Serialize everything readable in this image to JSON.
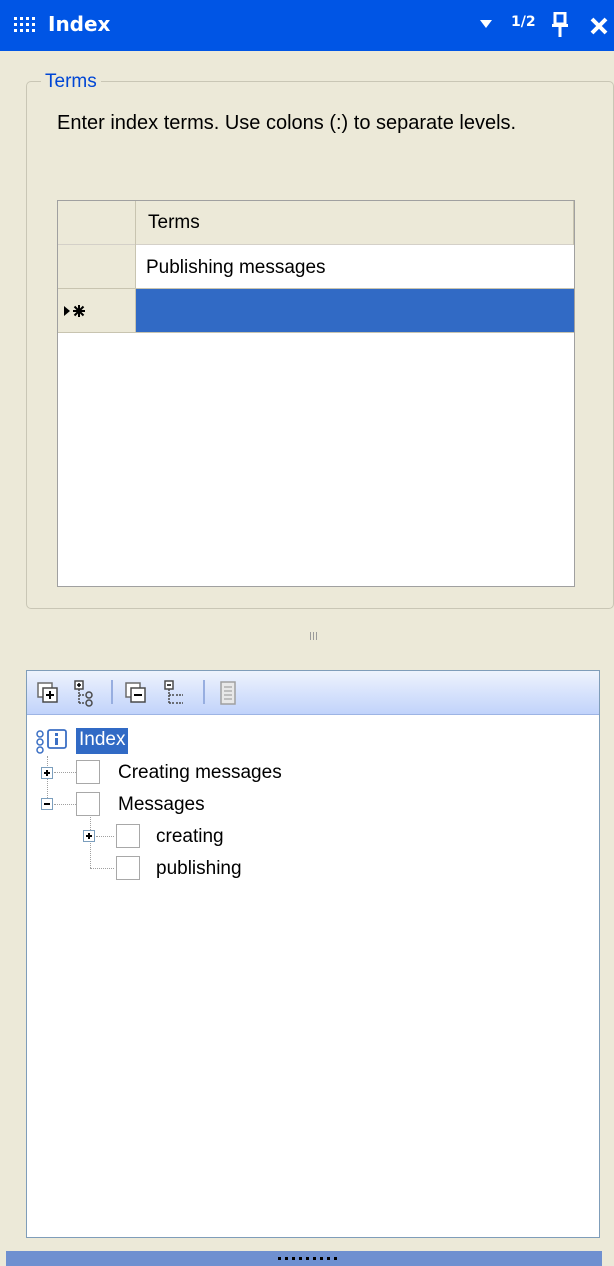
{
  "titlebar": {
    "title": "Index",
    "page_indicator": "1/2",
    "icons": [
      "grip-icon",
      "dropdown-arrow-icon",
      "pin-icon",
      "close-icon"
    ]
  },
  "terms_group": {
    "legend": "Terms",
    "instructions": "Enter index terms. Use colons (:) to separate levels."
  },
  "grid": {
    "column_header": "Terms",
    "rows": [
      {
        "value": "Publishing messages"
      },
      {
        "value": "",
        "new_row": true
      }
    ],
    "new_row_icon": "new-row-marker-icon"
  },
  "splitter": {
    "icon": "splitter-grip-icon"
  },
  "tree_toolbar": {
    "buttons": [
      "add-term-icon",
      "add-subterm-icon",
      "remove-term-icon",
      "remove-subterm-icon",
      "properties-icon"
    ]
  },
  "tree": {
    "root": "Index",
    "nodes": [
      {
        "label": "Creating messages",
        "expanded": false
      },
      {
        "label": "Messages",
        "expanded": true,
        "children": [
          {
            "label": "creating",
            "expanded": false
          },
          {
            "label": "publishing"
          }
        ]
      }
    ]
  },
  "colors": {
    "titlebar": "#0055e5",
    "selection": "#316ac5",
    "legend_text": "#0046d5",
    "panel_bg": "#ece9d8"
  }
}
